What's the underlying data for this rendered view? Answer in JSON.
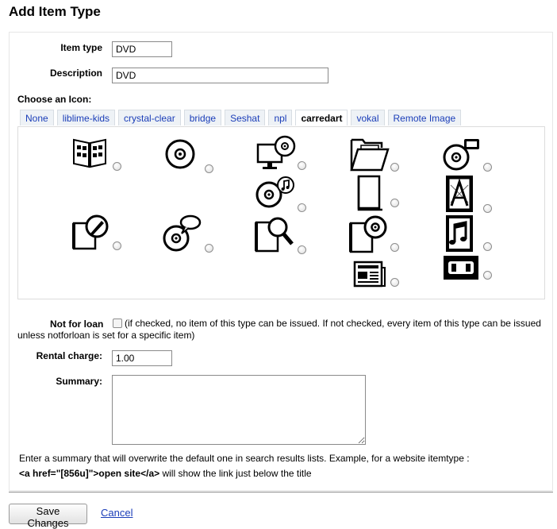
{
  "page": {
    "title": "Add Item Type"
  },
  "form": {
    "item_type_label": "Item type",
    "item_type_value": "DVD",
    "description_label": "Description",
    "description_value": "DVD",
    "choose_icon_label": "Choose an Icon:",
    "tabs": [
      {
        "label": "None"
      },
      {
        "label": "liblime-kids"
      },
      {
        "label": "crystal-clear"
      },
      {
        "label": "bridge"
      },
      {
        "label": "Seshat"
      },
      {
        "label": "npl"
      },
      {
        "label": "carredart",
        "active": true
      },
      {
        "label": "vokal"
      },
      {
        "label": "Remote Image"
      }
    ],
    "icons": [
      "film-book-icon",
      "disc-icon",
      "computer-disc-icon",
      "open-folder-icon",
      "disc-video-icon",
      "music-disc-icon",
      "closed-folder-icon",
      "art-book-icon",
      "book-pen-icon",
      "disc-speech-icon",
      "book-magnifier-icon",
      "book-disc-icon",
      "music-book-icon",
      "newspaper-icon",
      "videotape-icon"
    ],
    "not_for_loan_label": "Not for loan",
    "not_for_loan_help": "(if checked, no item of this type can be issued. If not checked, every item of this type can be issued unless notforloan is set for a specific item)",
    "rental_charge_label": "Rental charge:",
    "rental_charge_value": "1.00",
    "summary_label": "Summary:",
    "summary_value": "",
    "summary_note": "Enter a summary that will overwrite the default one in search results lists. Example, for a website itemtype :",
    "summary_example_code": "<a href=\"[856u]\">open site</a>",
    "summary_example_rest": " will show the link just below the title"
  },
  "actions": {
    "save_label": "Save Changes",
    "cancel_label": "Cancel"
  }
}
